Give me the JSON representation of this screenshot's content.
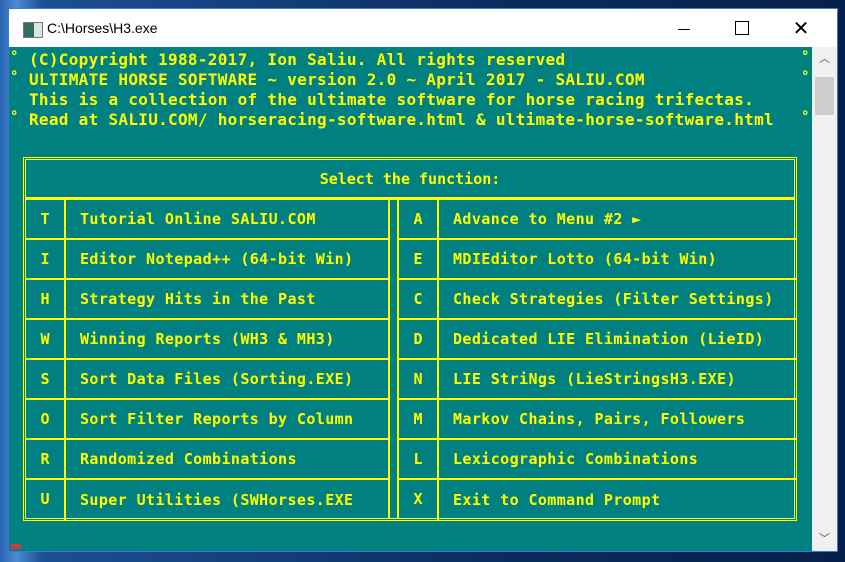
{
  "window": {
    "title": "C:\\Horses\\H3.exe",
    "controls": {
      "minimize": "minimize",
      "maximize": "maximize",
      "close": "✕"
    }
  },
  "header_lines": [
    "(C)Copyright 1988-2017, Ion Saliu. All rights reserved",
    "ULTIMATE HORSE SOFTWARE ~ version 2.0 ~ April 2017 - SALIU.COM",
    "This is a collection of the ultimate software for horse racing trifectas.",
    "Read at SALIU.COM/ horseracing-software.html & ultimate-horse-software.html"
  ],
  "bullet": "°",
  "menu": {
    "title": "Select the function:",
    "left": [
      {
        "key": "T",
        "label": "Tutorial Online SALIU.COM"
      },
      {
        "key": "I",
        "label": "Editor Notepad++ (64-bit Win)"
      },
      {
        "key": "H",
        "label": "Strategy Hits in the Past"
      },
      {
        "key": "W",
        "label": "Winning Reports (WH3 & MH3)"
      },
      {
        "key": "S",
        "label": "Sort Data Files (Sorting.EXE)"
      },
      {
        "key": "O",
        "label": "Sort Filter Reports by Column"
      },
      {
        "key": "R",
        "label": "Randomized Combinations"
      },
      {
        "key": "U",
        "label": "Super Utilities (SWHorses.EXE"
      }
    ],
    "right": [
      {
        "key": "A",
        "label": "Advance to Menu #2 ►"
      },
      {
        "key": "E",
        "label": "MDIEditor Lotto (64-bit Win)"
      },
      {
        "key": "C",
        "label": "Check Strategies (Filter Settings)"
      },
      {
        "key": "D",
        "label": "Dedicated LIE Elimination (LieID)"
      },
      {
        "key": "N",
        "label": "LIE StriNgs (LieStringsH3.EXE)"
      },
      {
        "key": "M",
        "label": "Markov Chains, Pairs, Followers"
      },
      {
        "key": "L",
        "label": "Lexicographic Combinations"
      },
      {
        "key": "X",
        "label": "Exit to Command Prompt"
      }
    ]
  },
  "colors": {
    "console_bg": "#008080",
    "text": "#ffff00",
    "cursor": "#c0404a"
  }
}
